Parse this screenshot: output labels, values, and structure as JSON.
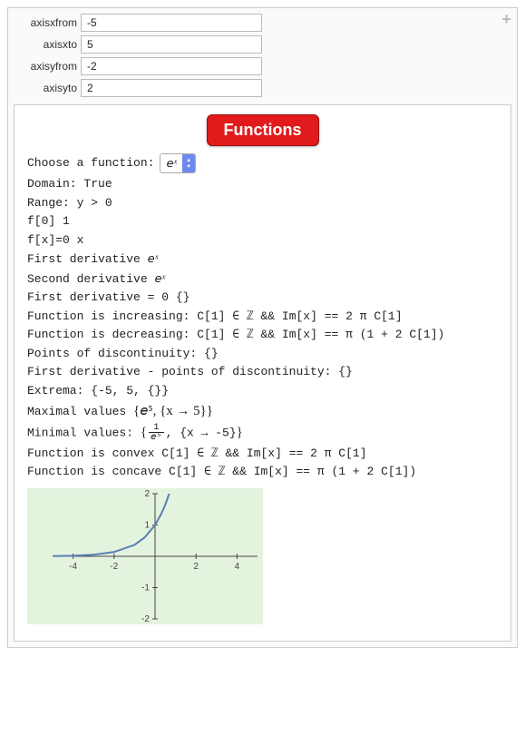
{
  "controls": {
    "axisxfrom": {
      "label": "axisxfrom",
      "value": "-5"
    },
    "axisxto": {
      "label": "axisxto",
      "value": "5"
    },
    "axisyfrom": {
      "label": "axisyfrom",
      "value": "-2"
    },
    "axisyto": {
      "label": "axisyto",
      "value": "2"
    }
  },
  "header_button": "Functions",
  "chooser_label": "Choose a function:",
  "selected_function_html": "𝘦ˣ",
  "lines": {
    "domain": "Domain: True",
    "range": "Range: y > 0",
    "f0": "f[0]  1",
    "fx0": "f[x]=0  x",
    "d1_label": "First derivative ",
    "d1_expr": "𝘦ˣ",
    "d2_label": "Second derivative ",
    "d2_expr": "𝘦ˣ",
    "d1_zero": "First derivative = 0 {}",
    "increasing": "Function is increasing: C[1] ∈ ℤ && Im[x] == 2 π C[1]",
    "decreasing": "Function is decreasing: C[1] ∈ ℤ && Im[x] == π (1 + 2 C[1])",
    "discont": "Points of discontinuity: {}",
    "d1_discont": "First derivative - points of discontinuity: {}",
    "extrema": "Extrema: {-5, 5, {}}",
    "maxvals_label": "Maximal values ",
    "maxvals_expr": "{𝘦⁵, {x → 5}}",
    "minvals_label": "Minimal values: ",
    "convex": "Function is convex C[1] ∈ ℤ && Im[x] == 2 π C[1]",
    "concave": "Function is concave C[1] ∈ ℤ && Im[x] == π (1 + 2 C[1])"
  },
  "minvals": {
    "frac_num": "1",
    "frac_den": "𝘦⁵",
    "rule": ", {x → -5}"
  },
  "chart_data": {
    "type": "line",
    "title": "",
    "xlabel": "",
    "ylabel": "",
    "xlim": [
      -5,
      5
    ],
    "ylim": [
      -2,
      2
    ],
    "xticks": [
      -4,
      -2,
      2,
      4
    ],
    "yticks": [
      -2,
      -1,
      1,
      2
    ],
    "series": [
      {
        "name": "e^x",
        "x": [
          -5,
          -4,
          -3,
          -2,
          -1,
          -0.5,
          0,
          0.3,
          0.5,
          0.69
        ],
        "y": [
          0.0067,
          0.018,
          0.05,
          0.135,
          0.368,
          0.607,
          1.0,
          1.35,
          1.649,
          2.0
        ]
      }
    ]
  }
}
